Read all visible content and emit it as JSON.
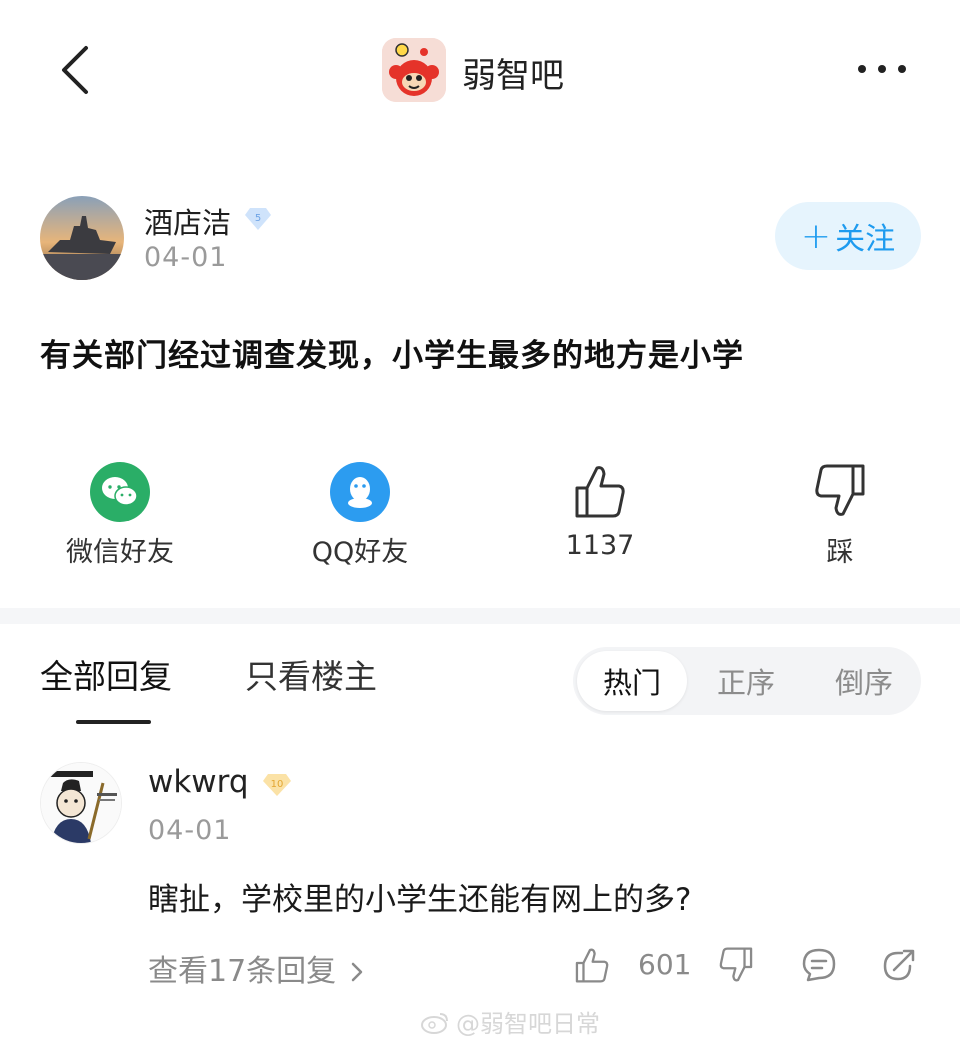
{
  "header": {
    "forum_name": "弱智吧"
  },
  "post": {
    "author": "酒店洁",
    "author_level": "5",
    "date": "04-01",
    "follow_label": "关注",
    "content": "有关部门经过调查发现，小学生最多的地方是小学"
  },
  "actions": {
    "wechat_label": "微信好友",
    "qq_label": "QQ好友",
    "like_count": "1137",
    "dislike_label": "踩"
  },
  "tabs": {
    "all_replies": "全部回复",
    "op_only": "只看楼主"
  },
  "sort": {
    "hot": "热门",
    "asc": "正序",
    "desc": "倒序"
  },
  "reply": {
    "user": "wkwrq",
    "level": "10",
    "date": "04-01",
    "text": "瞎扯，学校里的小学生还能有网上的多?",
    "view_replies": "查看17条回复",
    "like_count": "601"
  },
  "watermark": "@弱智吧日常",
  "colors": {
    "accent": "#1e9bef",
    "wechat": "#2aae67",
    "qq": "#2c9cf0"
  }
}
